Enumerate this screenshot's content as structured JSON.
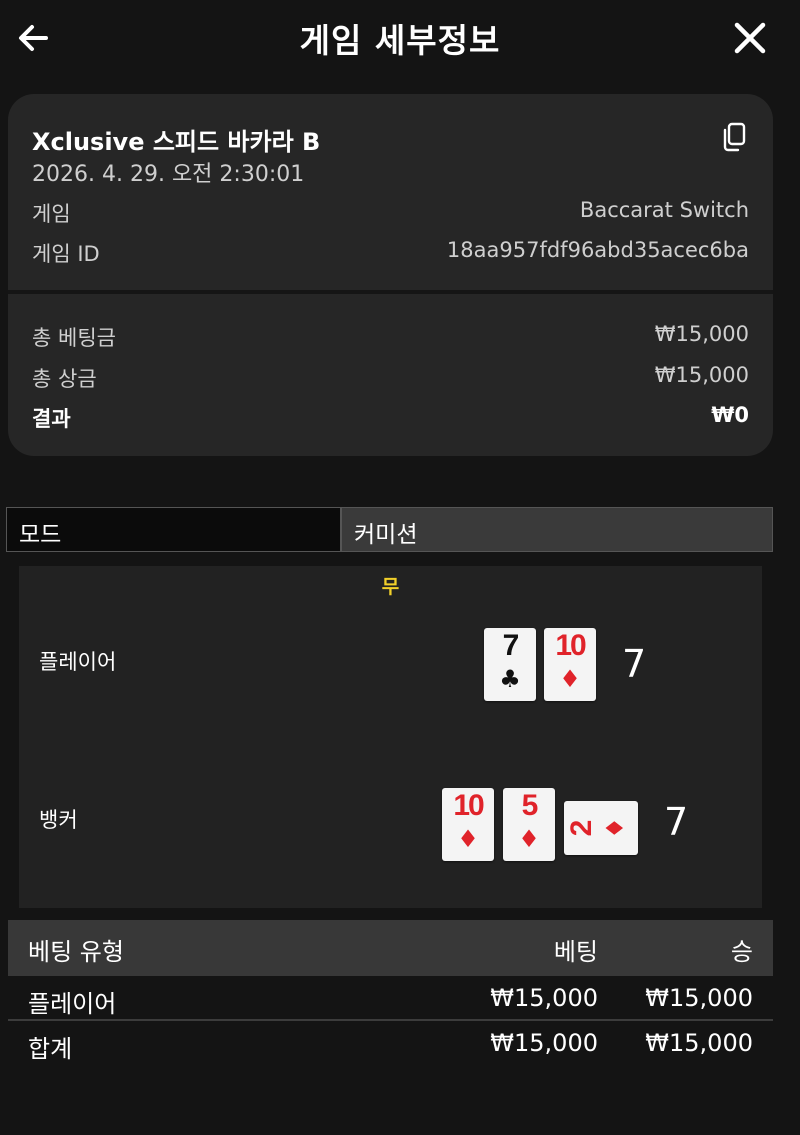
{
  "header": {
    "title": "게임 세부정보",
    "back_icon": "arrow-left-icon",
    "close_icon": "close-icon"
  },
  "summary": {
    "game_name": "Xclusive 스피드 바카라 B",
    "date": "2026. 4. 29. 오전 2:30:01",
    "copy_icon": "copy-icon",
    "game_label": "게임",
    "game_value": "Baccarat Switch",
    "game_id_label": "게임 ID",
    "game_id_value": "18aa957fdf96abd35acec6ba",
    "total_bet_label": "총 베팅금",
    "total_bet_value": "₩15,000",
    "total_win_label": "총 상금",
    "total_win_value": "₩15,000",
    "result_label": "결과",
    "result_value": "₩0"
  },
  "tabs": [
    {
      "label": "모드"
    },
    {
      "label": "커미션"
    }
  ],
  "board": {
    "outcome": "무",
    "player": {
      "label": "플레이어",
      "score": "7",
      "cards": [
        {
          "rank": "7",
          "suit": "♣",
          "color": "#111111"
        },
        {
          "rank": "10",
          "suit": "♦",
          "color": "#e0232a"
        }
      ]
    },
    "banker": {
      "label": "뱅커",
      "score": "7",
      "cards": [
        {
          "rank": "10",
          "suit": "♦",
          "color": "#e0232a"
        },
        {
          "rank": "5",
          "suit": "♦",
          "color": "#e0232a"
        },
        {
          "rank": "2",
          "suit": "♦",
          "color": "#e0232a"
        }
      ]
    }
  },
  "bets": {
    "headers": {
      "type": "베팅 유형",
      "bet": "베팅",
      "win": "승"
    },
    "rows": [
      {
        "type": "플레이어",
        "bet": "₩15,000",
        "win": "₩15,000"
      }
    ],
    "total": {
      "type": "합계",
      "bet": "₩15,000",
      "win": "₩15,000"
    }
  }
}
